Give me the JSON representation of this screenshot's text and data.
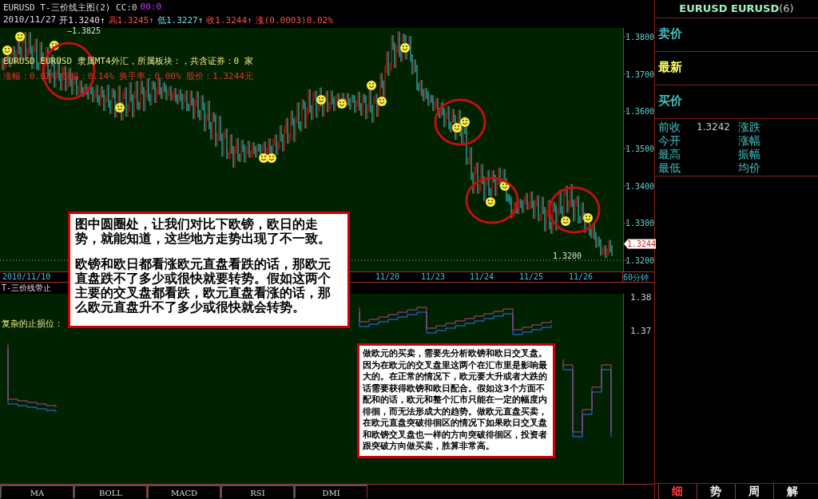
{
  "header": {
    "title": "EURUSD T-三价线主图(2) CC:0",
    "title_extra": "00:0",
    "date": "2010/11/27",
    "quotes": [
      {
        "label": "开1.3240",
        "arrow": "↑",
        "color": "#e0e0e0"
      },
      {
        "label": "高1.3245",
        "arrow": "↑",
        "color": "#ff5050"
      },
      {
        "label": "低1.3227",
        "arrow": "↑",
        "color": "#60e0e0"
      },
      {
        "label": "收1.3244",
        "arrow": "↑",
        "color": "#ff5050"
      },
      {
        "label": "涨(0.0003)0.02%",
        "color": "#ff5050"
      }
    ],
    "peak_label": "—1.3825"
  },
  "info": {
    "line1": "EURUSD EURUSD 隶属MT4外汇，所属板块：，共含证券：0 家",
    "line2": "涨幅：0.02% 振幅：0.14% 换手率：0.00% 股价：1.3244元"
  },
  "price_axis": {
    "ticks": [
      "1.3800",
      "1.3700",
      "1.3600",
      "1.3500",
      "1.3400",
      "1.3300",
      "1.3200"
    ],
    "current": "1.3244",
    "low_label": "1.3200"
  },
  "date_axis": {
    "labels": [
      "2010/11/10",
      "11/20",
      "11/23",
      "11/24",
      "11/25",
      "11/26"
    ],
    "period": "60分钟"
  },
  "lower_panel": {
    "title": "T-三价线带止",
    "label": "复杂的止损位：",
    "ticks": [
      "1.38",
      "1.37"
    ]
  },
  "indicator_tabs": [
    {
      "label": "MA"
    },
    {
      "label": "BOLL"
    },
    {
      "label": "MACD"
    },
    {
      "label": "RSI"
    },
    {
      "label": "DMI"
    }
  ],
  "side_panel": {
    "title": "EURUSD EURUSD",
    "title_count": "(6)",
    "quotes": [
      {
        "label": "卖价",
        "kind": "plain"
      },
      {
        "label": "最新",
        "kind": "latest"
      },
      {
        "label": "买价",
        "kind": "plain"
      }
    ],
    "stats": [
      {
        "label": "前收",
        "value": "1.3242",
        "label2": "涨跌"
      },
      {
        "label": "今开",
        "label2": "涨幅"
      },
      {
        "label": "最高",
        "label2": "振幅"
      },
      {
        "label": "最低",
        "label2": "均价"
      }
    ],
    "tabs": [
      {
        "label": "细",
        "selected": true
      },
      {
        "label": "势",
        "selected": false
      },
      {
        "label": "周",
        "selected": false
      },
      {
        "label": "解",
        "selected": false
      }
    ]
  },
  "callouts": [
    {
      "paragraphs": [
        "图中圆圈处，让我们对比下欧镑，欧日的走势，就能知道，这些地方走势出现了不一致。",
        "欧镑和欧日都看涨欧元直盘看跌的话，那欧元直盘跌不了多少或很快就要转势。假如这两个主要的交叉盘都看跌，欧元直盘看涨的话，那么欧元直盘升不了多少或很快就会转势。"
      ]
    },
    {
      "paragraphs": [
        "做欧元的买卖，需要先分析欧镑和欧日交叉盘。因为在欧元的交叉盘里这两个在汇市里是影响最大的。在正常的情况下，欧元要大升或者大跌的话需要获得欧镑和欧日配合。假如这3个方面不配和的话，欧元和整个汇市只能在一定的幅度内徘徊，而无法形成大的趋势。做欧元直盘买卖，在欧元直盘突破徘徊区的情况下如果欧日交叉盘和欧镑交叉盘也一样的方向突破徘徊区，投资者跟突破方向做买卖，胜算非常高。"
      ]
    }
  ]
}
